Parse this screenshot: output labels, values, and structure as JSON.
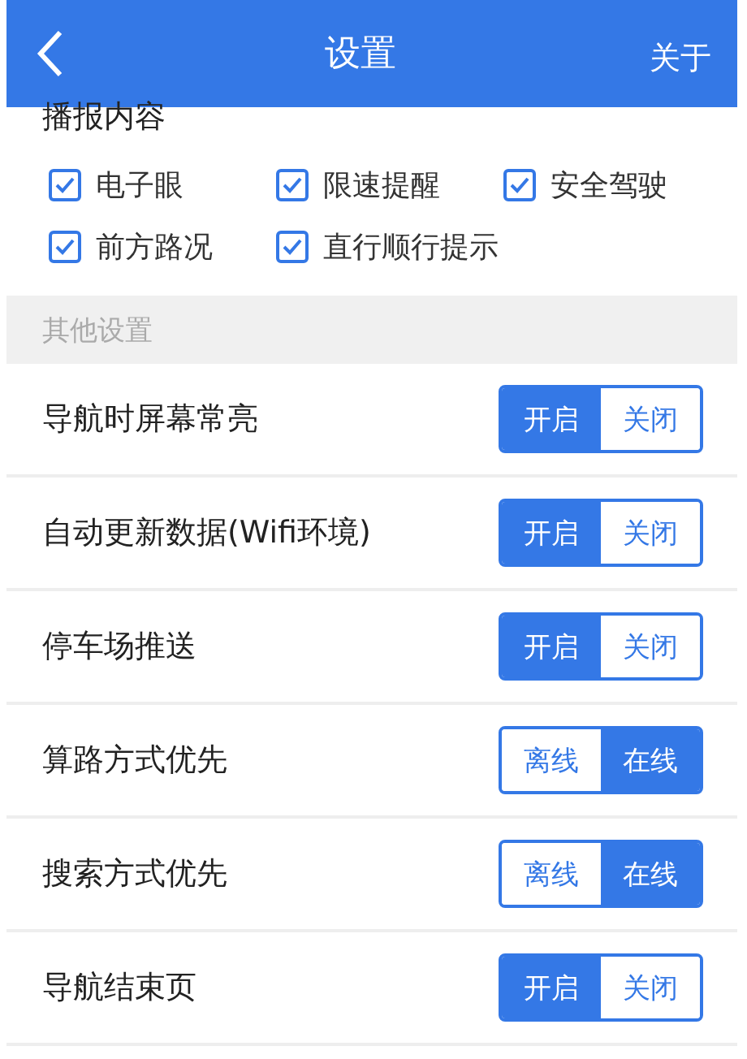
{
  "header": {
    "title": "设置",
    "action": "关于"
  },
  "broadcast": {
    "title": "播报内容",
    "options": [
      {
        "label": "电子眼",
        "checked": true
      },
      {
        "label": "限速提醒",
        "checked": true
      },
      {
        "label": "安全驾驶",
        "checked": true
      },
      {
        "label": "前方路况",
        "checked": true
      },
      {
        "label": "直行顺行提示",
        "checked": true
      }
    ]
  },
  "other_section": {
    "title": "其他设置"
  },
  "settings": [
    {
      "label": "导航时屏幕常亮",
      "options": [
        {
          "label": "开启",
          "selected": true
        },
        {
          "label": "关闭",
          "selected": false
        }
      ]
    },
    {
      "label": "自动更新数据(Wifi环境)",
      "options": [
        {
          "label": "开启",
          "selected": true
        },
        {
          "label": "关闭",
          "selected": false
        }
      ]
    },
    {
      "label": "停车场推送",
      "options": [
        {
          "label": "开启",
          "selected": true
        },
        {
          "label": "关闭",
          "selected": false
        }
      ]
    },
    {
      "label": "算路方式优先",
      "options": [
        {
          "label": "离线",
          "selected": false
        },
        {
          "label": "在线",
          "selected": true
        }
      ]
    },
    {
      "label": "搜索方式优先",
      "options": [
        {
          "label": "离线",
          "selected": false
        },
        {
          "label": "在线",
          "selected": true
        }
      ]
    },
    {
      "label": "导航结束页",
      "options": [
        {
          "label": "开启",
          "selected": true
        },
        {
          "label": "关闭",
          "selected": false
        }
      ]
    }
  ]
}
